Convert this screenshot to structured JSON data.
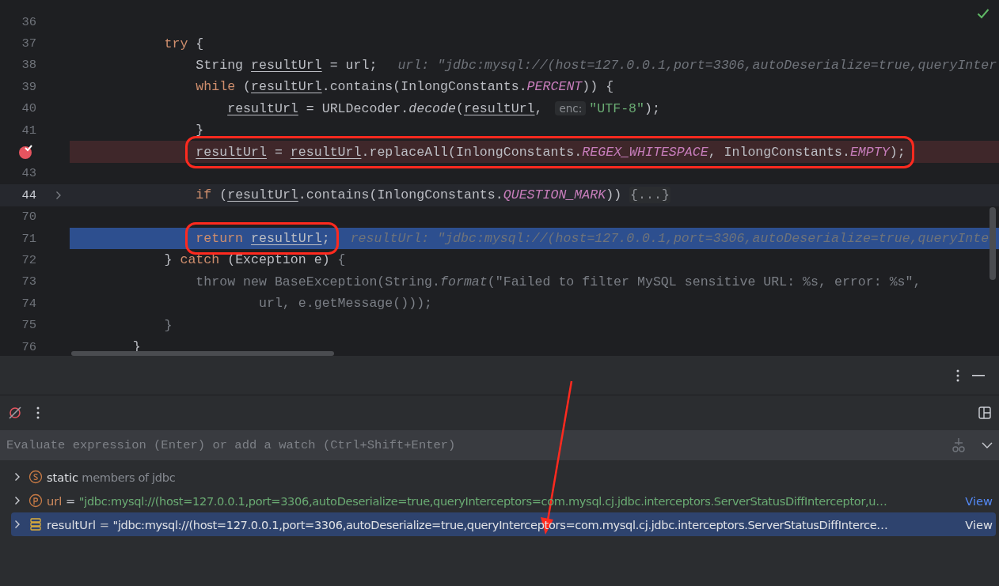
{
  "editor": {
    "lines": [
      {
        "number": "36",
        "breakpoint": false,
        "execution": false,
        "caret": false,
        "foldable": false,
        "annotated": false
      },
      {
        "number": "37",
        "breakpoint": false,
        "execution": false,
        "caret": false,
        "foldable": false,
        "annotated": false,
        "tokens": [
          {
            "kind": "kw",
            "text": "            try"
          },
          {
            "kind": "plain",
            "text": " {"
          }
        ]
      },
      {
        "number": "38",
        "breakpoint": false,
        "execution": false,
        "caret": false,
        "foldable": false,
        "annotated": false,
        "tokens": [
          {
            "kind": "plain",
            "text": "                String "
          },
          {
            "kind": "var",
            "text": "resultUrl"
          },
          {
            "kind": "plain",
            "text": " = url;"
          },
          {
            "kind": "hint",
            "text": "url: \"jdbc:mysql://(host=127.0.0.1,port=3306,autoDeserialize=true,queryInter"
          }
        ]
      },
      {
        "number": "39",
        "breakpoint": false,
        "execution": false,
        "caret": false,
        "foldable": false,
        "annotated": false,
        "tokens": [
          {
            "kind": "kw",
            "text": "                while"
          },
          {
            "kind": "plain",
            "text": " ("
          },
          {
            "kind": "var",
            "text": "resultUrl"
          },
          {
            "kind": "plain",
            "text": ".contains(InlongConstants."
          },
          {
            "kind": "const",
            "text": "PERCENT"
          },
          {
            "kind": "plain",
            "text": ")) {"
          }
        ]
      },
      {
        "number": "40",
        "breakpoint": false,
        "execution": false,
        "caret": false,
        "foldable": false,
        "annotated": false,
        "tokens": [
          {
            "kind": "var",
            "text": "                    resultUrl"
          },
          {
            "kind": "plain",
            "text": " = URLDecoder."
          },
          {
            "kind": "method",
            "text": "decode"
          },
          {
            "kind": "plain",
            "text": "("
          },
          {
            "kind": "var",
            "text": "resultUrl"
          },
          {
            "kind": "plain",
            "text": ", "
          },
          {
            "kind": "inlay",
            "text": "enc:"
          },
          {
            "kind": "str",
            "text": "\"UTF-8\""
          },
          {
            "kind": "plain",
            "text": ");"
          }
        ]
      },
      {
        "number": "41",
        "breakpoint": false,
        "execution": false,
        "caret": false,
        "foldable": false,
        "annotated": false,
        "tokens": [
          {
            "kind": "plain",
            "text": "                }"
          }
        ]
      },
      {
        "breakpoint": true,
        "execution": false,
        "caret": false,
        "foldable": false,
        "annotated": true,
        "tokens": [
          {
            "kind": "var",
            "text": "resultUrl"
          },
          {
            "kind": "plain",
            "text": " = "
          },
          {
            "kind": "var",
            "text": "resultUrl"
          },
          {
            "kind": "plain",
            "text": ".replaceAll(InlongConstants."
          },
          {
            "kind": "const",
            "text": "REGEX_WHITESPACE"
          },
          {
            "kind": "plain",
            "text": ", InlongConstants."
          },
          {
            "kind": "const",
            "text": "EMPTY"
          },
          {
            "kind": "plain",
            "text": ");"
          }
        ]
      },
      {
        "number": "43",
        "breakpoint": false,
        "execution": false,
        "caret": false,
        "foldable": false,
        "annotated": false
      },
      {
        "number": "44",
        "breakpoint": false,
        "execution": false,
        "caret": true,
        "foldable": true,
        "annotated": false,
        "tokens": [
          {
            "kind": "kw",
            "text": "                if"
          },
          {
            "kind": "plain",
            "text": " ("
          },
          {
            "kind": "var",
            "text": "resultUrl"
          },
          {
            "kind": "plain",
            "text": ".contains(InlongConstants."
          },
          {
            "kind": "const",
            "text": "QUESTION_MARK"
          },
          {
            "kind": "plain",
            "text": ")) "
          },
          {
            "kind": "fold",
            "text": "{...}"
          }
        ]
      },
      {
        "number": "70",
        "breakpoint": false,
        "execution": false,
        "caret": false,
        "foldable": false,
        "annotated": false
      },
      {
        "number": "71",
        "breakpoint": false,
        "execution": true,
        "caret": false,
        "foldable": false,
        "annotated": true,
        "tokens": [
          {
            "kind": "kw",
            "text": "return "
          },
          {
            "kind": "var",
            "text": "resultUrl"
          },
          {
            "kind": "plain",
            "text": ";"
          },
          {
            "kind": "hint",
            "text": "resultUrl: \"jdbc:mysql://(host=127.0.0.1,port=3306,autoDeserialize=true,queryInte"
          }
        ]
      },
      {
        "number": "72",
        "breakpoint": false,
        "execution": false,
        "caret": false,
        "foldable": false,
        "annotated": false,
        "tokens": [
          {
            "kind": "plain",
            "text": "            } "
          },
          {
            "kind": "kw",
            "text": "catch"
          },
          {
            "kind": "plain",
            "text": " (Exception e) "
          },
          {
            "kind": "dim",
            "text": "{"
          }
        ]
      },
      {
        "number": "73",
        "breakpoint": false,
        "execution": false,
        "caret": false,
        "foldable": false,
        "annotated": false,
        "tokens": [
          {
            "kind": "dim",
            "text": "                throw new BaseException(String."
          },
          {
            "kind": "dimi",
            "text": "format"
          },
          {
            "kind": "dim",
            "text": "(\"Failed to filter MySQL sensitive URL: %s, error: %s\","
          }
        ]
      },
      {
        "number": "74",
        "breakpoint": false,
        "execution": false,
        "caret": false,
        "foldable": false,
        "annotated": false,
        "tokens": [
          {
            "kind": "dim",
            "text": "                        url, e.getMessage()));"
          }
        ]
      },
      {
        "number": "75",
        "breakpoint": false,
        "execution": false,
        "caret": false,
        "foldable": false,
        "annotated": false,
        "tokens": [
          {
            "kind": "dim",
            "text": "            }"
          }
        ]
      },
      {
        "number": "76",
        "breakpoint": false,
        "execution": false,
        "caret": false,
        "foldable": false,
        "annotated": false,
        "tokens": [
          {
            "kind": "plain",
            "text": "        }"
          }
        ]
      }
    ]
  },
  "debugger": {
    "expression_field": {
      "placeholder": "Evaluate expression (Enter) or add a watch (Ctrl+Shift+Enter)"
    },
    "variables": [
      {
        "kind": "static",
        "name": "static",
        "value": "members of jdbc",
        "selected": false
      },
      {
        "kind": "param",
        "name": "url",
        "operator": "=",
        "value": "\"jdbc:mysql://(host=127.0.0.1,port=3306,autoDeserialize=true,queryInterceptors=com.mysql.cj.jdbc.interceptors.ServerStatusDiffInterceptor,u…",
        "link": "View",
        "selected": false
      },
      {
        "kind": "field",
        "name": "resultUrl",
        "operator": "=",
        "value": "\"jdbc:mysql://(host=127.0.0.1,port=3306,autoDeserialize=true,queryInterceptors=com.mysql.cj.jdbc.interceptors.ServerStatusDiffInterce…",
        "link": "View",
        "selected": true
      }
    ]
  },
  "annotations": [
    {
      "kind": "arrow"
    }
  ]
}
